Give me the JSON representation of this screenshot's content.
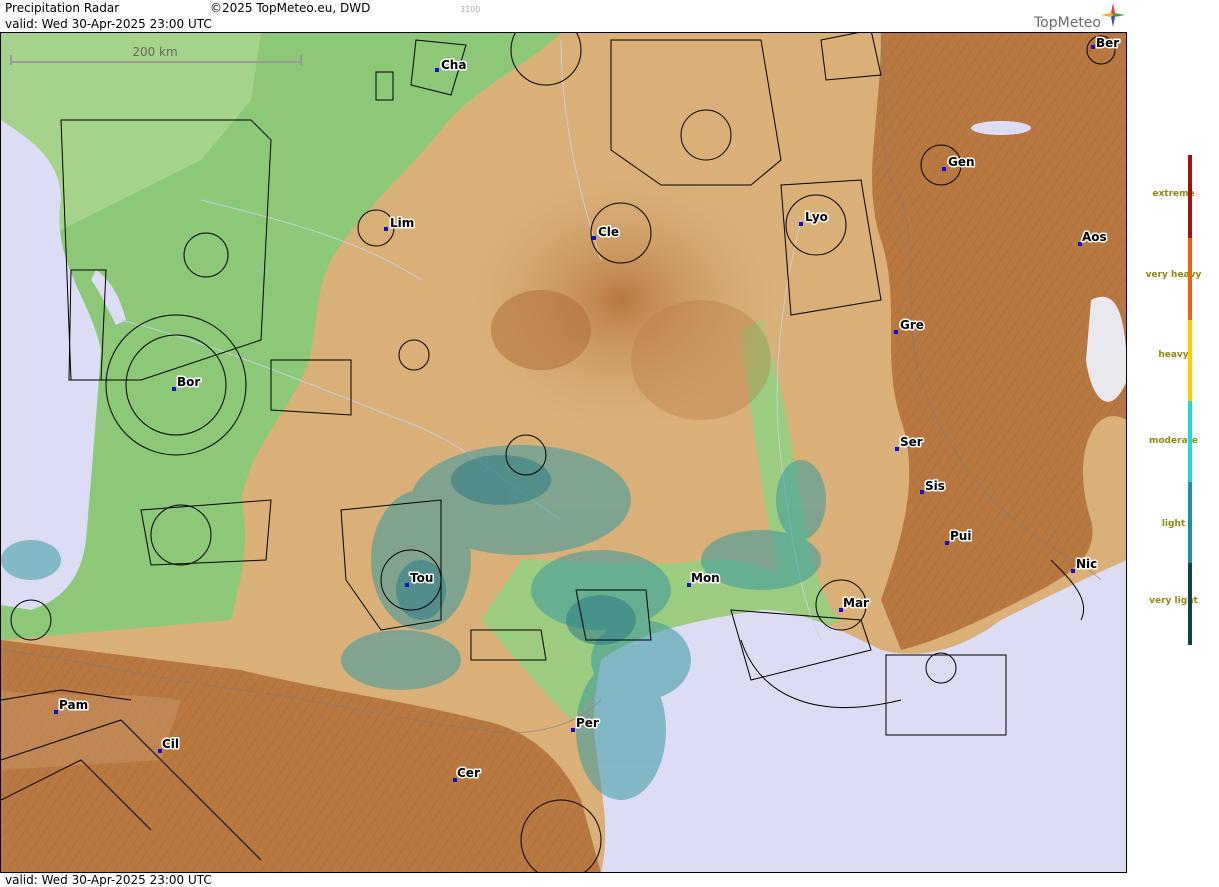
{
  "header": {
    "title": "Precipitation Radar",
    "copyright": "©2025 TopMeteo.eu, DWD",
    "valid_top": "valid:  Wed  30-Apr-2025 23:00 UTC",
    "code": "3100",
    "logo": "TopMeteo"
  },
  "footer": {
    "valid_bottom": "valid:  Wed  30-Apr-2025 23:00 UTC"
  },
  "scale_bar": {
    "label": "200 km"
  },
  "cities": [
    {
      "name": "Cha"
    },
    {
      "name": "Ber"
    },
    {
      "name": "Gen"
    },
    {
      "name": "Lim"
    },
    {
      "name": "Cle"
    },
    {
      "name": "Lyo"
    },
    {
      "name": "Aos"
    },
    {
      "name": "Gre"
    },
    {
      "name": "Bor"
    },
    {
      "name": "Ser"
    },
    {
      "name": "Sis"
    },
    {
      "name": "Pui"
    },
    {
      "name": "Tou"
    },
    {
      "name": "Mon"
    },
    {
      "name": "Mar"
    },
    {
      "name": "Nic"
    },
    {
      "name": "Pam"
    },
    {
      "name": "Per"
    },
    {
      "name": "Cil"
    },
    {
      "name": "Cer"
    }
  ],
  "legend": {
    "items": [
      {
        "label": "extreme",
        "color": "#a01010"
      },
      {
        "label": "very heavy",
        "color": "#e86010"
      },
      {
        "label": "heavy",
        "color": "#f8d000"
      },
      {
        "label": "moderate",
        "color": "#20d8d8"
      },
      {
        "label": "light",
        "color": "#2090a0"
      },
      {
        "label": "very light",
        "color": "#104050"
      }
    ]
  },
  "colors": {
    "sea": "#dcdcf4",
    "lowland": "#8cc878",
    "hills": "#d8b078",
    "mountains": "#b87840",
    "radar": "#3a9aa0"
  }
}
